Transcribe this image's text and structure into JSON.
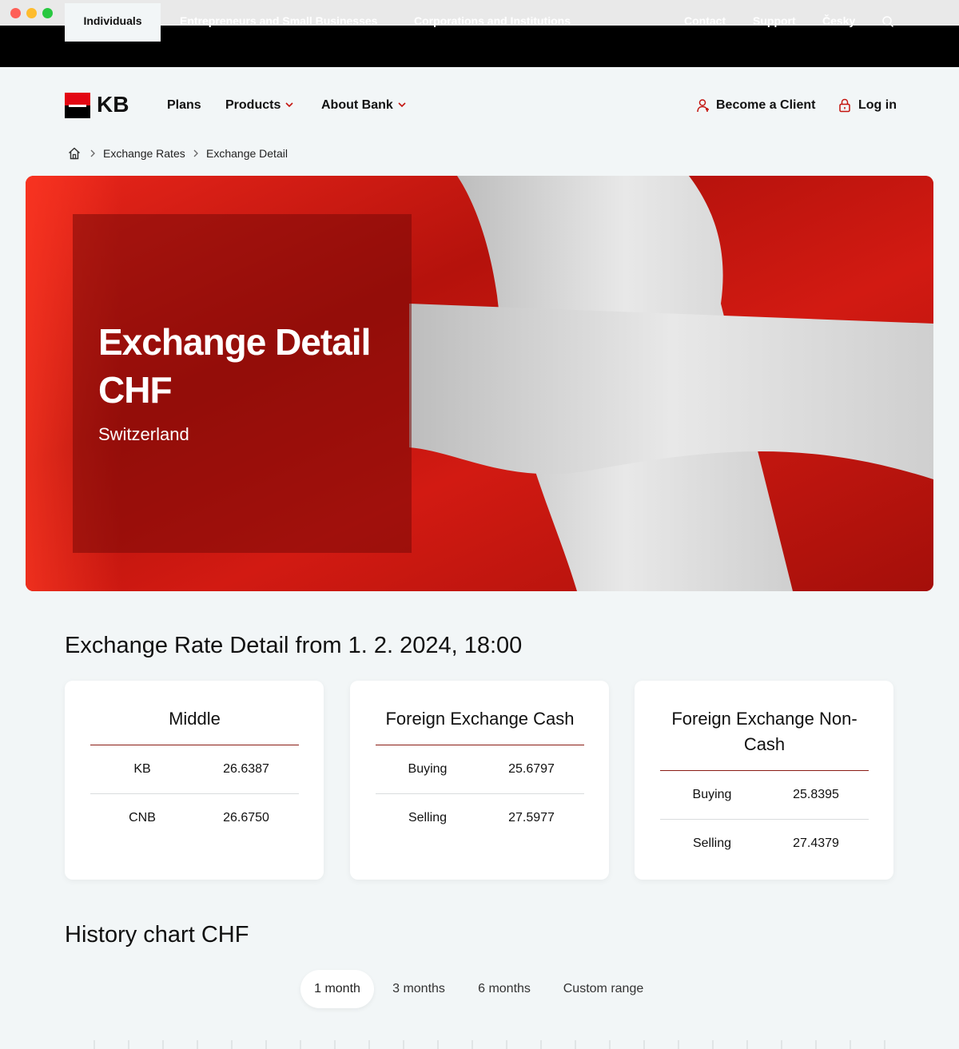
{
  "topbar": {
    "segments": [
      "Individuals",
      "Entrepreneurs and Small Businesses",
      "Corporations and Institutions"
    ],
    "contact": "Contact",
    "support": "Support",
    "language": "Česky"
  },
  "nav": {
    "logo_text": "KB",
    "plans": "Plans",
    "products": "Products",
    "about": "About Bank",
    "become_client": "Become a Client",
    "login": "Log in"
  },
  "breadcrumb": {
    "items": [
      "Exchange Rates",
      "Exchange Detail"
    ]
  },
  "hero": {
    "title_line1": "Exchange Detail",
    "title_line2": "CHF",
    "subtitle": "Switzerland"
  },
  "rates": {
    "heading": "Exchange Rate Detail from 1. 2. 2024, 18:00",
    "cards": [
      {
        "title": "Middle",
        "rows": [
          {
            "label": "KB",
            "value": "26.6387"
          },
          {
            "label": "CNB",
            "value": "26.6750"
          }
        ]
      },
      {
        "title": "Foreign Exchange Cash",
        "rows": [
          {
            "label": "Buying",
            "value": "25.6797"
          },
          {
            "label": "Selling",
            "value": "27.5977"
          }
        ]
      },
      {
        "title_line1": "Foreign Exchange Non-",
        "title_line2": "Cash",
        "rows": [
          {
            "label": "Buying",
            "value": "25.8395"
          },
          {
            "label": "Selling",
            "value": "27.4379"
          }
        ]
      }
    ]
  },
  "history": {
    "heading": "History chart CHF",
    "tabs": [
      "1 month",
      "3 months",
      "6 months",
      "Custom range"
    ],
    "active_tab": "1 month"
  },
  "colors": {
    "brand_red": "#e30613",
    "topbar_bg": "#000000",
    "page_bg": "#f2f6f7",
    "card_rule": "#8a1c14"
  }
}
